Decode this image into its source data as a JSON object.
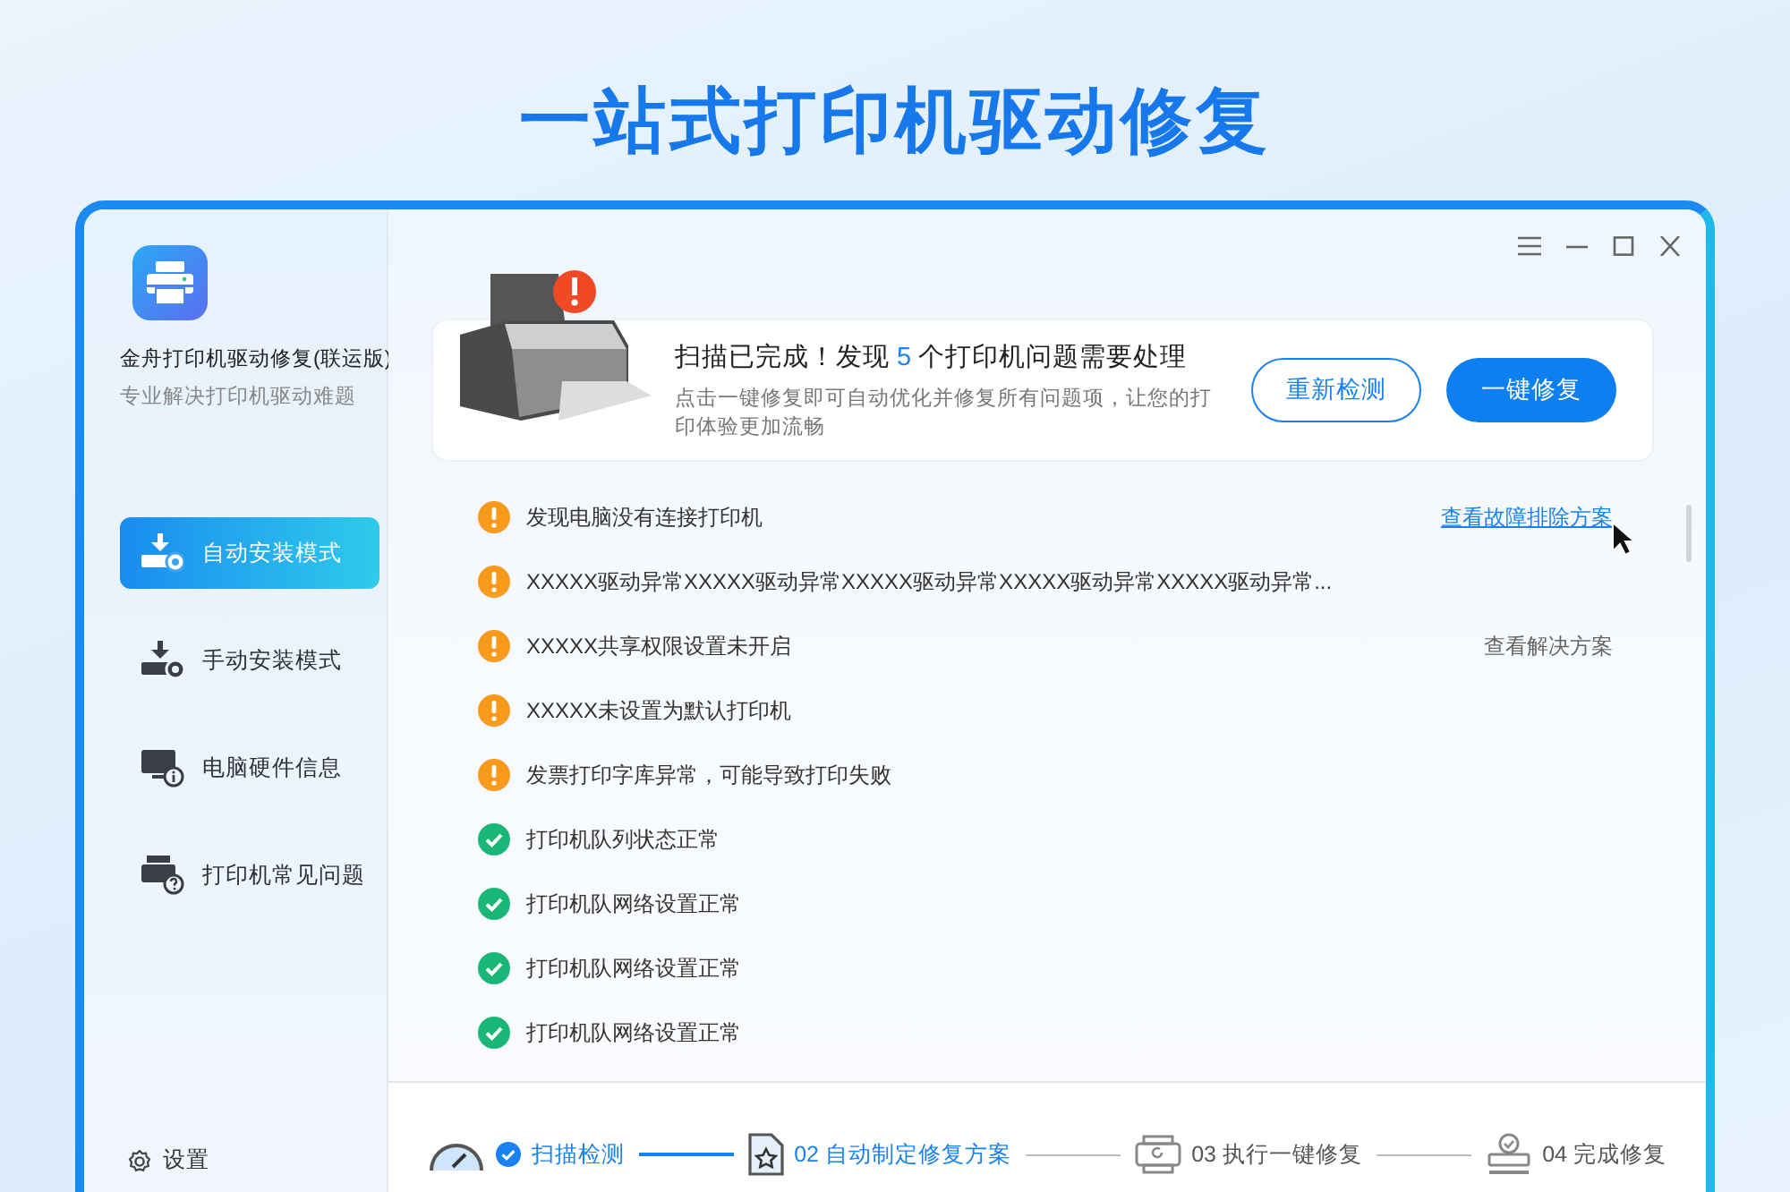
{
  "headline": "一站式打印机驱动修复",
  "app": {
    "name": "金舟打印机驱动修复(联运版)",
    "tagline": "专业解决打印机驱动难题"
  },
  "sidebar": {
    "items": [
      {
        "label": "自动安装模式",
        "kind": "auto",
        "selected": true
      },
      {
        "label": "手动安装模式",
        "kind": "manual",
        "selected": false
      },
      {
        "label": "电脑硬件信息",
        "kind": "hardware",
        "selected": false
      },
      {
        "label": "打印机常见问题",
        "kind": "faq",
        "selected": false
      }
    ],
    "settings": "设置"
  },
  "summary": {
    "title_start": "扫描已完成！发现",
    "count": "5",
    "title_end": "个打印机问题需要处理",
    "description": "点击一键修复即可自动优化并修复所有问题项，让您的打印体验更加流畅",
    "buttons": [
      {
        "label": "重新检测",
        "kind": "outline"
      },
      {
        "label": "一键修复",
        "kind": "primary"
      }
    ]
  },
  "issues": [
    {
      "kind": "warning",
      "text": "发现电脑没有连接打印机",
      "action": {
        "label": "查看故障排除方案",
        "kind": "link"
      }
    },
    {
      "kind": "warning",
      "text": "XXXXX驱动异常XXXXX驱动异常XXXXX驱动异常XXXXX驱动异常XXXXX驱动异常..."
    },
    {
      "kind": "warning",
      "text": "XXXXX共享权限设置未开启",
      "action": {
        "label": "查看解决方案",
        "kind": "plain"
      }
    },
    {
      "kind": "warning",
      "text": "XXXXX未设置为默认打印机"
    },
    {
      "kind": "warning",
      "text": "发票打印字库异常，可能导致打印失败"
    },
    {
      "kind": "ok",
      "text": "打印机队列状态正常"
    },
    {
      "kind": "ok",
      "text": "打印机队网络设置正常"
    },
    {
      "kind": "ok",
      "text": "打印机队网络设置正常"
    },
    {
      "kind": "ok",
      "text": "打印机队网络设置正常"
    }
  ],
  "steps": [
    {
      "kind": "scan",
      "label": "扫描检测",
      "done": true,
      "active": false
    },
    {
      "kind": "plan",
      "label": "02 自动制定修复方案",
      "done": false,
      "active": true
    },
    {
      "kind": "execute",
      "label": "03 执行一键修复",
      "done": false,
      "active": false
    },
    {
      "kind": "finish",
      "label": "04 完成修复",
      "done": false,
      "active": false
    }
  ]
}
